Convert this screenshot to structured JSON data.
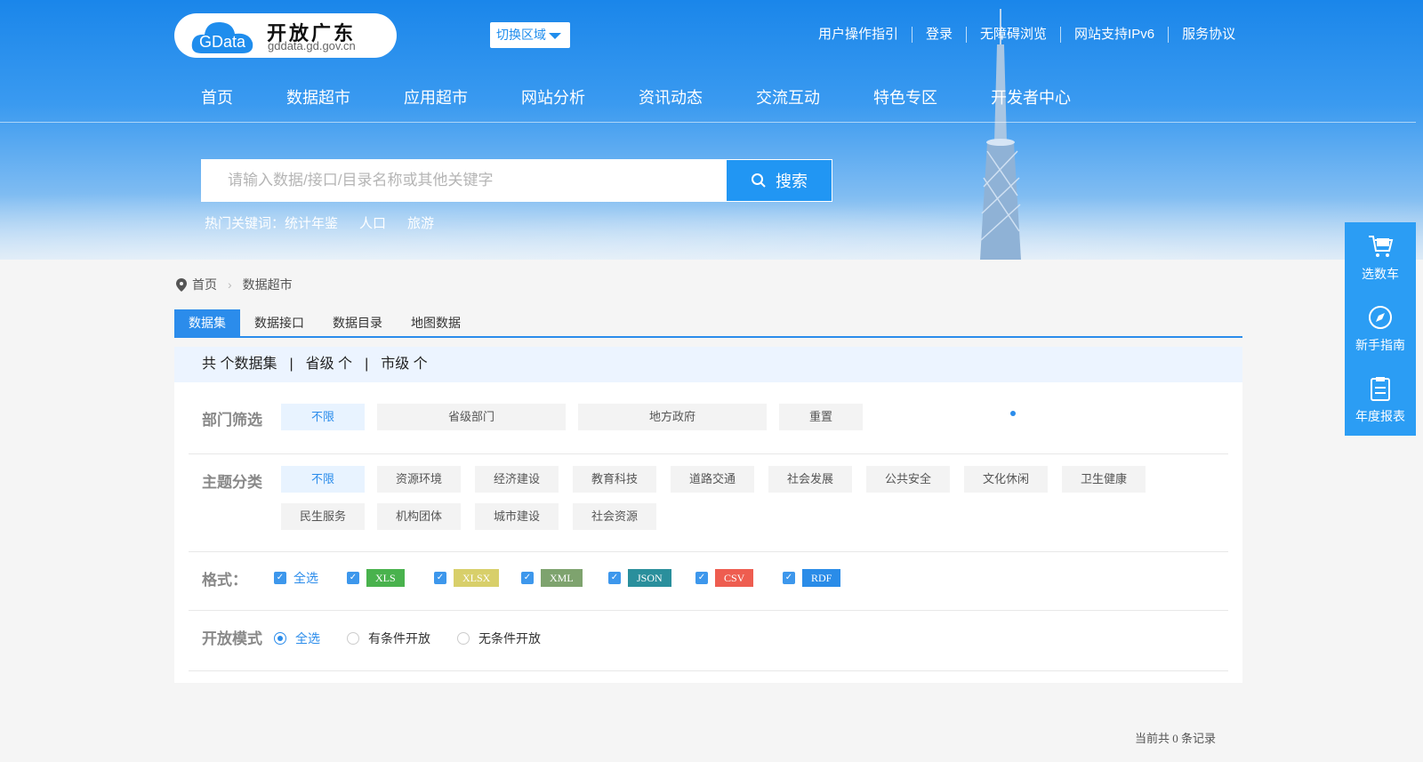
{
  "header": {
    "logo_badge": "GData",
    "logo_brand": "开放广东",
    "logo_domain": "gddata.gd.gov.cn",
    "region_button": "切换区域",
    "top_links": [
      "用户操作指引",
      "登录",
      "无障碍浏览",
      "网站支持IPv6",
      "服务协议"
    ],
    "nav": [
      "首页",
      "数据超市",
      "应用超市",
      "网站分析",
      "资讯动态",
      "交流互动",
      "特色专区",
      "开发者中心"
    ]
  },
  "search": {
    "placeholder": "请输入数据/接口/目录名称或其他关键字",
    "button": "搜索",
    "hot_label": "热门关键词：",
    "hot_keywords": [
      "统计年鉴",
      "人口",
      "旅游"
    ]
  },
  "side_float": [
    "选数车",
    "新手指南",
    "年度报表"
  ],
  "breadcrumb": [
    "首页",
    "数据超市"
  ],
  "tabs": [
    "数据集",
    "数据接口",
    "数据目录",
    "地图数据"
  ],
  "summary": {
    "total": "共 个数据集",
    "province": "省级 个",
    "city": "市级 个",
    "separator": "|"
  },
  "filters": {
    "dept_label": "部门筛选",
    "dept_options": [
      "不限",
      "省级部门",
      "地方政府",
      "重置"
    ],
    "topic_label": "主题分类",
    "topic_options": [
      "不限",
      "资源环境",
      "经济建设",
      "教育科技",
      "道路交通",
      "社会发展",
      "公共安全",
      "文化休闲",
      "卫生健康",
      "民生服务",
      "机构团体",
      "城市建设",
      "社会资源"
    ],
    "format_label": "格式：",
    "format_all": "全选",
    "formats": [
      {
        "label": "XLS",
        "color": "#49b24d"
      },
      {
        "label": "XLSX",
        "color": "#d8cf6a"
      },
      {
        "label": "XML",
        "color": "#7ea36e"
      },
      {
        "label": "JSON",
        "color": "#2a8f9c"
      },
      {
        "label": "CSV",
        "color": "#ee5d50"
      },
      {
        "label": "RDF",
        "color": "#2a8ce8"
      }
    ],
    "mode_label": "开放模式",
    "mode_options": [
      "全选",
      "有条件开放",
      "无条件开放"
    ]
  },
  "footer": {
    "count_text": "当前共 0 条记录"
  },
  "colors": {
    "primary": "#2b8ceb",
    "accent": "#2196f3"
  }
}
